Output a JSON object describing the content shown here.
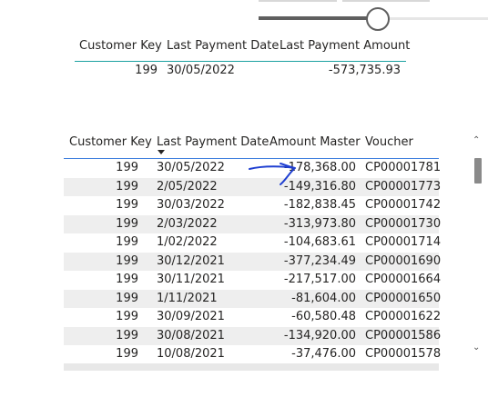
{
  "slider": {
    "value_fraction": 0.52
  },
  "summary_table": {
    "headers": [
      "Customer Key",
      "Last Payment Date",
      "Last Payment Amount"
    ],
    "row": {
      "customer_key": "199",
      "last_payment_date": "30/05/2022",
      "last_payment_amount": "-573,735.93"
    }
  },
  "detail_table": {
    "headers": [
      "Customer Key",
      "Last Payment Date",
      "Amount Master",
      "Voucher"
    ],
    "rows": [
      {
        "key": "199",
        "date": "30/05/2022",
        "amount": "-178,368.00",
        "voucher": "CP00001781"
      },
      {
        "key": "199",
        "date": "2/05/2022",
        "amount": "-149,316.80",
        "voucher": "CP00001773"
      },
      {
        "key": "199",
        "date": "30/03/2022",
        "amount": "-182,838.45",
        "voucher": "CP00001742"
      },
      {
        "key": "199",
        "date": "2/03/2022",
        "amount": "-313,973.80",
        "voucher": "CP00001730"
      },
      {
        "key": "199",
        "date": "1/02/2022",
        "amount": "-104,683.61",
        "voucher": "CP00001714"
      },
      {
        "key": "199",
        "date": "30/12/2021",
        "amount": "-377,234.49",
        "voucher": "CP00001690"
      },
      {
        "key": "199",
        "date": "30/11/2021",
        "amount": "-217,517.00",
        "voucher": "CP00001664"
      },
      {
        "key": "199",
        "date": "1/11/2021",
        "amount": "-81,604.00",
        "voucher": "CP00001650"
      },
      {
        "key": "199",
        "date": "30/09/2021",
        "amount": "-60,580.48",
        "voucher": "CP00001622"
      },
      {
        "key": "199",
        "date": "30/08/2021",
        "amount": "-134,920.00",
        "voucher": "CP00001586"
      },
      {
        "key": "199",
        "date": "10/08/2021",
        "amount": "-37,476.00",
        "voucher": "CP00001578"
      }
    ]
  },
  "scrollbar": {
    "up_icon": "chevron-up-icon",
    "down_icon": "chevron-down-icon",
    "up_glyph": "⌃",
    "down_glyph": "⌄"
  },
  "colors": {
    "annotation_arrow": "#1f3fd1",
    "header_underline_1": "#1aa1a1",
    "header_underline_2": "#3b7ddd"
  }
}
